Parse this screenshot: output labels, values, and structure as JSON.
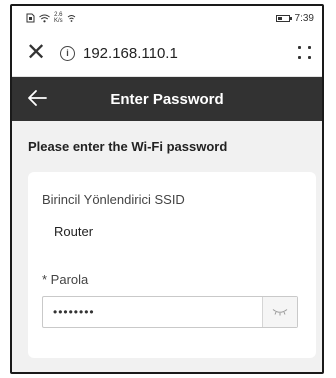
{
  "statusbar": {
    "speed_value": "2.6",
    "speed_unit": "K/s",
    "time": "7:39"
  },
  "browser": {
    "url": "192.168.110.1"
  },
  "appbar": {
    "title": "Enter Password"
  },
  "page": {
    "prompt": "Please enter the Wi-Fi password",
    "ssid_label": "Birincil Yönlendirici SSID",
    "ssid_value": "Router",
    "password_label": "* Parola",
    "password_value": "••••••••"
  },
  "colors": {
    "appbar_bg": "#323232",
    "content_bg": "#f1f1f1"
  }
}
